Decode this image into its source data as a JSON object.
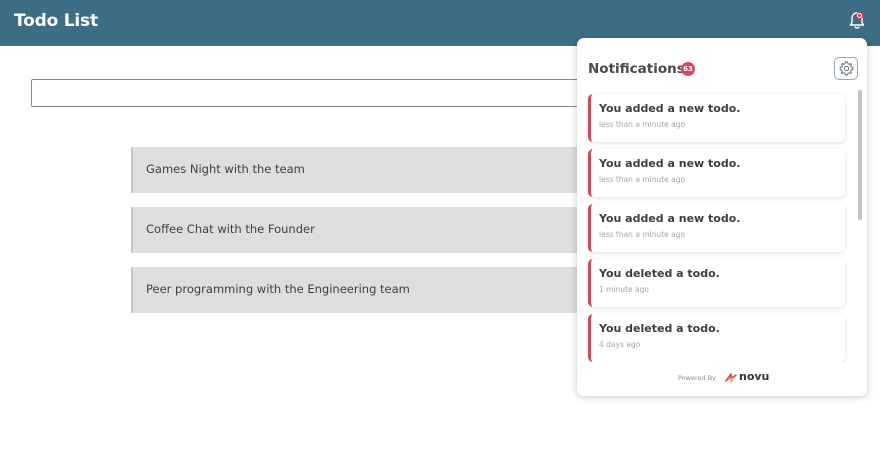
{
  "header": {
    "title": "Todo List",
    "bell_icon": "bell-icon",
    "accent": "#3e6e86"
  },
  "todo_input": {
    "value": "",
    "placeholder": ""
  },
  "todos": [
    {
      "text": "Games Night with the team"
    },
    {
      "text": "Coffee Chat with the Founder"
    },
    {
      "text": "Peer programming with the Engineering team"
    }
  ],
  "notifications_panel": {
    "title": "Notifications",
    "unread_count": "63",
    "settings_icon": "gear-icon",
    "items": [
      {
        "title": "You added a new todo.",
        "time": "less than a minute ago"
      },
      {
        "title": "You added a new todo.",
        "time": "less than a minute ago"
      },
      {
        "title": "You added a new todo.",
        "time": "less than a minute ago"
      },
      {
        "title": "You deleted a todo.",
        "time": "1 minute ago"
      },
      {
        "title": "You deleted a todo.",
        "time": "4 days ago"
      }
    ],
    "footer": {
      "powered_by": "Powered By",
      "brand": "novu"
    },
    "unread_border_color": "#c84a5b"
  }
}
